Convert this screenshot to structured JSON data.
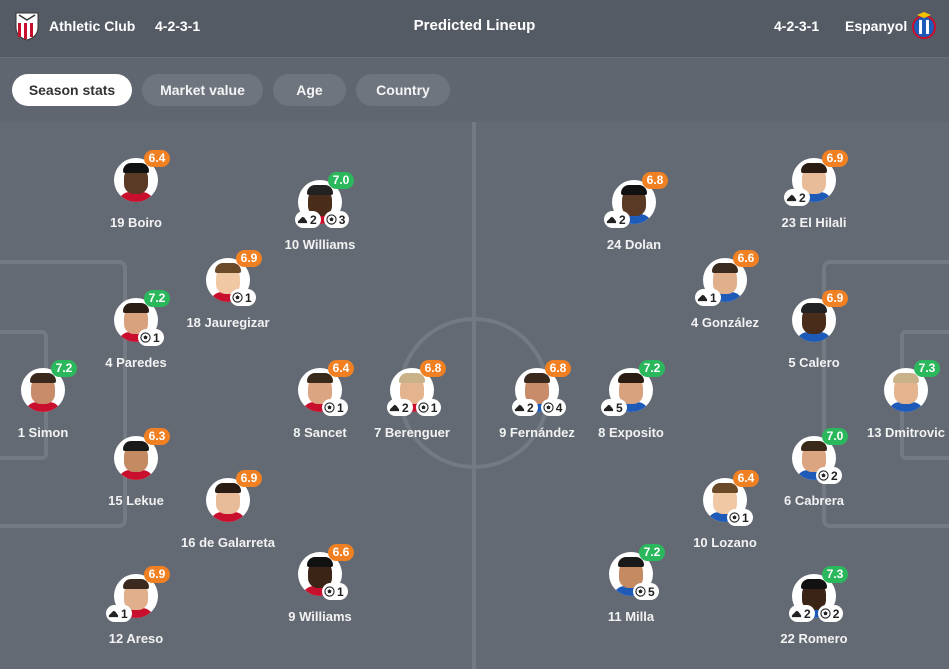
{
  "header": {
    "home_team": "Athletic Club",
    "home_formation": "4-2-3-1",
    "title": "Predicted Lineup",
    "away_formation": "4-2-3-1",
    "away_team": "Espanyol"
  },
  "tabs": [
    "Season stats",
    "Market value",
    "Age",
    "Country"
  ],
  "home_players": [
    {
      "name": "1 Simon",
      "rating": "7.2",
      "color": "green",
      "badges": []
    },
    {
      "name": "19 Boiro",
      "rating": "6.4",
      "color": "orange",
      "badges": []
    },
    {
      "name": "4 Paredes",
      "rating": "7.2",
      "color": "green",
      "badges": [
        {
          "icon": "goal",
          "count": "1"
        }
      ]
    },
    {
      "name": "15 Lekue",
      "rating": "6.3",
      "color": "orange",
      "badges": []
    },
    {
      "name": "12 Areso",
      "rating": "6.9",
      "color": "orange",
      "badges": [
        {
          "icon": "assist",
          "count": "1"
        }
      ]
    },
    {
      "name": "18 Jauregizar",
      "rating": "6.9",
      "color": "orange",
      "badges": [
        {
          "icon": "goal",
          "count": "1"
        }
      ]
    },
    {
      "name": "16 de Galarreta",
      "rating": "6.9",
      "color": "orange",
      "badges": []
    },
    {
      "name": "10 Williams",
      "rating": "7.0",
      "color": "green",
      "badges": [
        {
          "icon": "assist",
          "count": "2"
        },
        {
          "icon": "goal",
          "count": "3"
        }
      ]
    },
    {
      "name": "8 Sancet",
      "rating": "6.4",
      "color": "orange",
      "badges": [
        {
          "icon": "goal",
          "count": "1"
        }
      ]
    },
    {
      "name": "9 Williams",
      "rating": "6.6",
      "color": "orange",
      "badges": [
        {
          "icon": "goal",
          "count": "1"
        }
      ]
    },
    {
      "name": "7 Berenguer",
      "rating": "6.8",
      "color": "orange",
      "badges": [
        {
          "icon": "assist",
          "count": "2"
        },
        {
          "icon": "goal",
          "count": "1"
        }
      ]
    }
  ],
  "away_players": [
    {
      "name": "9 Fernández",
      "rating": "6.8",
      "color": "orange",
      "badges": [
        {
          "icon": "assist",
          "count": "2"
        },
        {
          "icon": "goal",
          "count": "4"
        }
      ]
    },
    {
      "name": "24 Dolan",
      "rating": "6.8",
      "color": "orange",
      "badges": [
        {
          "icon": "assist",
          "count": "2"
        }
      ]
    },
    {
      "name": "8 Exposito",
      "rating": "7.2",
      "color": "green",
      "badges": [
        {
          "icon": "assist",
          "count": "5"
        }
      ]
    },
    {
      "name": "11 Milla",
      "rating": "7.2",
      "color": "green",
      "badges": [
        {
          "icon": "goal",
          "count": "5"
        }
      ]
    },
    {
      "name": "4 González",
      "rating": "6.6",
      "color": "orange",
      "badges": [
        {
          "icon": "assist",
          "count": "1"
        }
      ]
    },
    {
      "name": "10 Lozano",
      "rating": "6.4",
      "color": "orange",
      "badges": [
        {
          "icon": "goal",
          "count": "1"
        }
      ]
    },
    {
      "name": "23 El Hilali",
      "rating": "6.9",
      "color": "orange",
      "badges": [
        {
          "icon": "assist",
          "count": "2"
        }
      ]
    },
    {
      "name": "5 Calero",
      "rating": "6.9",
      "color": "orange",
      "badges": []
    },
    {
      "name": "6 Cabrera",
      "rating": "7.0",
      "color": "green",
      "badges": [
        {
          "icon": "goal",
          "count": "2"
        }
      ]
    },
    {
      "name": "22 Romero",
      "rating": "7.3",
      "color": "green",
      "badges": [
        {
          "icon": "assist",
          "count": "2"
        },
        {
          "icon": "goal",
          "count": "2"
        }
      ]
    },
    {
      "name": "13 Dmitrovic",
      "rating": "7.3",
      "color": "green",
      "badges": []
    }
  ],
  "colors": {
    "orange": "#f08022",
    "green": "#2bb85c",
    "pitch": "#636a74"
  }
}
